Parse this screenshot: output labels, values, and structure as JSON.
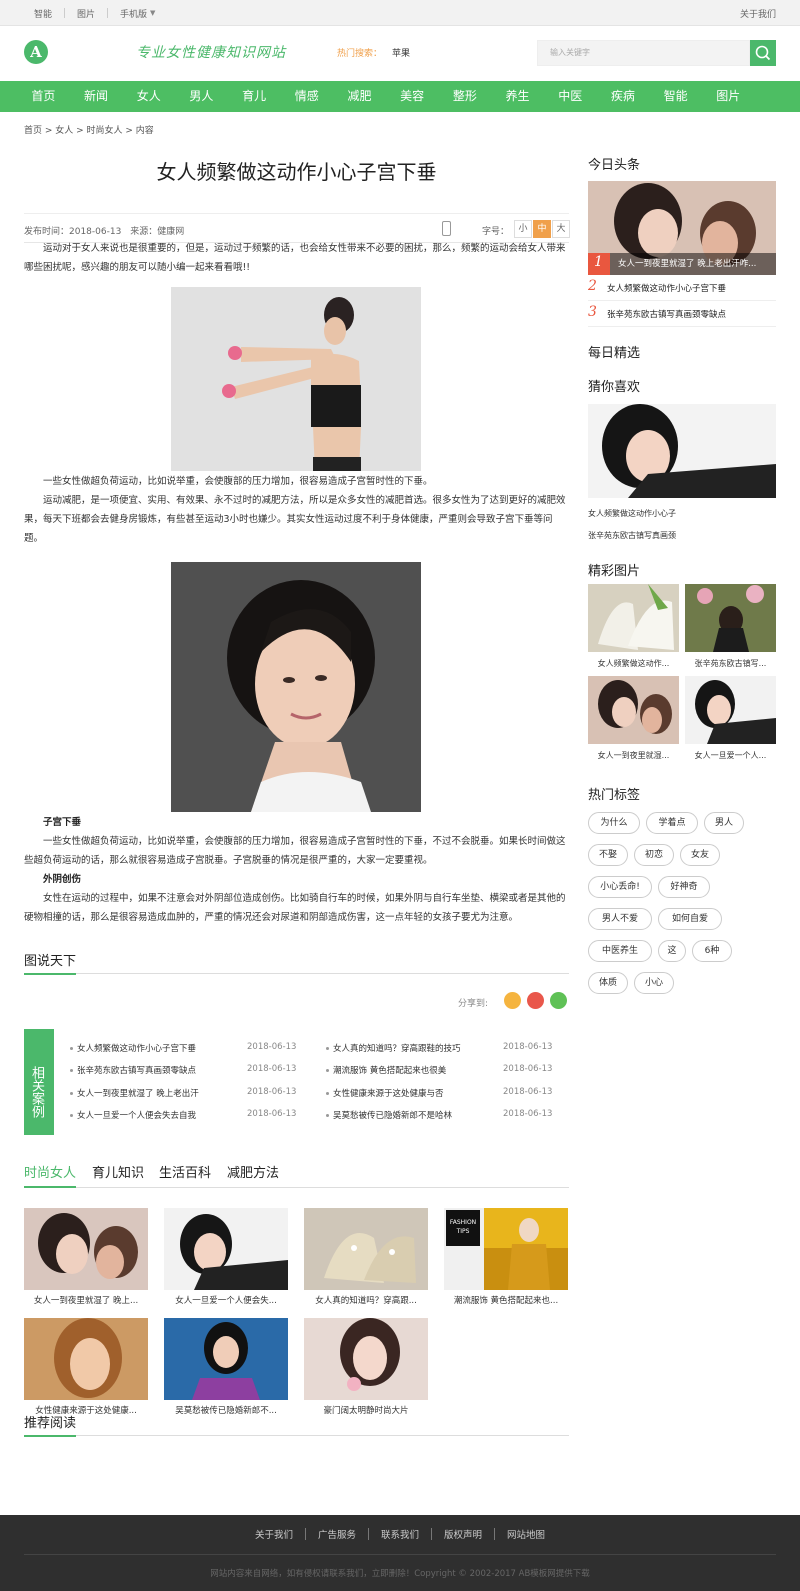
{
  "topbar": {
    "links": [
      "智能",
      "图片",
      "手机版"
    ],
    "right": "关于我们"
  },
  "header": {
    "logo": "A",
    "slogan": "专业女性健康知识网站",
    "hot_label": "热门搜索：",
    "hot_word": "苹果",
    "search_placeholder": "输入关键字"
  },
  "nav": [
    "首页",
    "新闻",
    "女人",
    "男人",
    "育儿",
    "情感",
    "减肥",
    "美容",
    "整形",
    "养生",
    "中医",
    "疾病",
    "智能",
    "图片"
  ],
  "breadcrumb": "首页 > 女人 > 时尚女人 > 内容",
  "article": {
    "title": "女人频繁做这动作小心子宫下垂",
    "meta": "发布时间：2018-06-13　来源：健康网",
    "font_label": "字号：",
    "font_sizes": [
      "小",
      "中",
      "大"
    ],
    "p1": "运动对于女人来说也是很重要的，但是，运动过于频繁的话，也会给女性带来不必要的困扰，那么，频繁的运动会给女人带来哪些困扰呢，感兴趣的朋友可以随小编一起来看看哦!!",
    "p2": "一些女性做超负荷运动，比如说举重，会使腹部的压力增加，很容易造成子宫暂时性的下垂。",
    "p3": "运动减肥，是一项便宜、实用、有效果、永不过时的减肥方法，所以是众多女性的减肥首选。很多女性为了达到更好的减肥效果，每天下班都会去健身房锻炼，有些甚至运动3小时也嫌少。其实女性运动过度不利于身体健康，严重则会导致子宫下垂等问题。",
    "h1": "子宫下垂",
    "p4": "一些女性做超负荷运动，比如说举重，会使腹部的压力增加，很容易造成子宫暂时性的下垂，不过不会脱垂。如果长时间做这些超负荷运动的话，那么就很容易造成子宫脱垂。子宫脱垂的情况是很严重的，大家一定要重视。",
    "h2": "外阴创伤",
    "p5": "女性在运动的过程中，如果不注意会对外阴部位造成创伤。比如骑自行车的时候，如果外阴与自行车坐垫、横梁或者是其他的硬物相撞的话，那么是很容易造成血肿的，严重的情况还会对尿道和阴部造成伤害，这一点年轻的女孩子要尤为注意。"
  },
  "tushuo": {
    "title": "图说天下",
    "share_label": "分享到:"
  },
  "related": {
    "tag": "相关案例",
    "items": [
      {
        "title": "女人频繁做这动作小心子宫下垂",
        "date": "2018-06-13"
      },
      {
        "title": "女人真的知道吗？穿高跟鞋的技巧",
        "date": "2018-06-13"
      },
      {
        "title": "张辛苑东欧古镇写真画颈零缺点",
        "date": "2018-06-13"
      },
      {
        "title": "潮流服饰 黄色搭配起来也很美",
        "date": "2018-06-13"
      },
      {
        "title": "女人一到夜里就湿了 晚上老出汗",
        "date": "2018-06-13"
      },
      {
        "title": "女性健康来源于这处健康与否",
        "date": "2018-06-13"
      },
      {
        "title": "女人一旦爱一个人便会失去自我",
        "date": "2018-06-13"
      },
      {
        "title": "吴莫愁被传已隐婚新郎不是哈林",
        "date": "2018-06-13"
      }
    ]
  },
  "tabs": [
    "时尚女人",
    "育儿知识",
    "生活百科",
    "减肥方法"
  ],
  "gallery": [
    "女人一到夜里就湿了 晚上...",
    "女人一旦爱一个人便会失...",
    "女人真的知道吗？穿高跟...",
    "潮流服饰 黄色搭配起来也...",
    "女性健康来源于这处健康...",
    "吴莫愁被传已隐婚新郎不...",
    "豪门阔太明静时尚大片"
  ],
  "fashion_tips": "FASHION TIPS",
  "recommend": "推荐阅读",
  "side": {
    "toutiao": "今日头条",
    "headline_caption": "女人一到夜里就湿了 晚上老出汗咋...",
    "ranks": [
      "1",
      "2",
      "3"
    ],
    "rank_items": [
      "女人频繁做这动作小心子宫下垂",
      "张辛苑东欧古镇写真画颈零缺点"
    ],
    "jingxuan": "每日精选",
    "guess": "猜你喜欢",
    "guess_items": [
      "女人频繁做这动作小心子",
      "张辛苑东欧古镇写真画颈"
    ],
    "pics_title": "精彩图片",
    "pics": [
      "女人频繁做这动作...",
      "张辛苑东欧古镇写...",
      "女人一到夜里就湿...",
      "女人一旦爱一个人..."
    ],
    "tags_title": "热门标签",
    "tags": [
      "为什么",
      "学着点",
      "男人",
      "不娶",
      "初恋",
      "女友",
      "小心丢命!",
      "好神奇",
      "男人不爱",
      "如何自爱",
      "中医养生",
      "这",
      "6种",
      "体质",
      "小心"
    ]
  },
  "footer": {
    "links": [
      "关于我们",
      "广告服务",
      "联系我们",
      "版权声明",
      "网站地图"
    ],
    "copy": "网站内容来自网络，如有侵权请联系我们，立即删除！Copyright © 2002-2017 AB模板网提供下载"
  },
  "colors": {
    "accent": "#4bb86b",
    "nav": "#4dbe63",
    "hot": "#f0a04b",
    "rank": "#e9573f",
    "footer": "#2f2f2f"
  }
}
